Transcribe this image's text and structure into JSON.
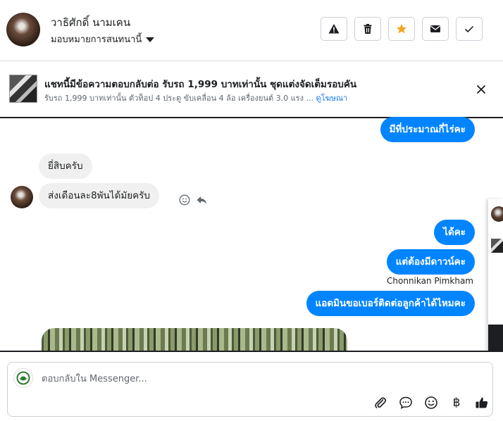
{
  "header": {
    "contact_name": "วาธิศักดิ์ นามเคน",
    "assign_label": "มอบหมายการสนทนานี้"
  },
  "ad": {
    "title": "แชทนี้มีข้อความตอบกลับต่อ รับรถ 1,999 บาทเท่านั้น ชุดแต่งจัดเต็มรอบคัน",
    "subtitle": "รับรถ 1,999 บาทเท่านั้น ตัวท็อป 4 ประตู ขับเคลื่อน 4 ล้อ เครื่องยนต์ 3.0 แรง ...",
    "link": "ดูโฆษณา"
  },
  "messages": {
    "m1": "มีที่ประมาณกี่ไร่คะ",
    "m2": "ยี่สิบครับ",
    "m3": "ส่งเดือนละ8พันได้มัยครับ",
    "m4": "ได้คะ",
    "m5": "แต่ต้องมีดาวน์คะ",
    "m6_sender": "Chonnikan Pimkham",
    "m7": "แอดมินขอเบอร์ติดต่อลูกค้าได้ไหมคะ"
  },
  "composer": {
    "placeholder": "ตอบกลับใน Messenger..."
  },
  "colors": {
    "outgoing_bubble": "#0084ff",
    "incoming_bubble": "#f0f0f0",
    "star": "#f5a623"
  }
}
